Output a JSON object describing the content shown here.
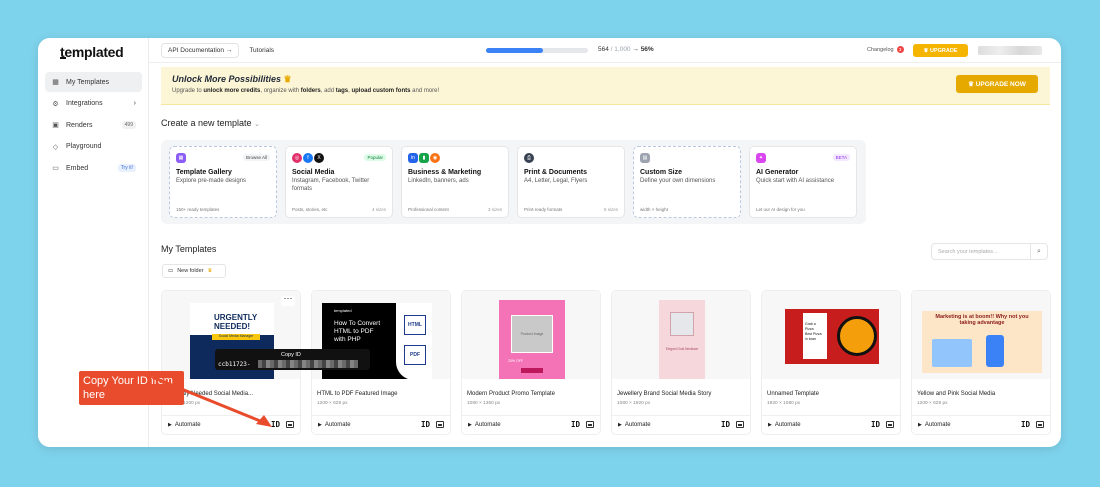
{
  "app": {
    "logo": "templated"
  },
  "sidebar": {
    "items": [
      {
        "label": "My Templates",
        "icon": "grid-icon",
        "badge": ""
      },
      {
        "label": "Integrations",
        "icon": "plug-icon",
        "badge": "›"
      },
      {
        "label": "Renders",
        "icon": "image-icon",
        "badge": "499"
      },
      {
        "label": "Playground",
        "icon": "gamepad-icon",
        "badge": ""
      },
      {
        "label": "Embed",
        "icon": "embed-icon",
        "badge": "Try it!"
      }
    ]
  },
  "topbar": {
    "api_docs": "API Documentation",
    "api_arrow": "→",
    "tutorials": "Tutorials",
    "usage": "564",
    "limit": "/ 1,000",
    "arrow": "→",
    "percent": "56%",
    "progress": 0.56,
    "changelog": "Changelog",
    "changelog_count": "3",
    "upgrade": "UPGRADE"
  },
  "banner": {
    "title": "Unlock More Possibilities",
    "sub_1": "Upgrade to ",
    "sub_b1": "unlock more credits",
    "sub_2": ", organize with ",
    "sub_b2": "folders",
    "sub_3": ", add ",
    "sub_b3": "tags",
    "sub_4": ", ",
    "sub_b4": "upload custom fonts",
    "sub_5": " and more!",
    "button": "UPGRADE NOW"
  },
  "create": {
    "title": "Create a new template",
    "chevron": "⌄",
    "cards": [
      {
        "title": "Template Gallery",
        "desc": "Explore pre-made designs",
        "foot": "150+ ready templates",
        "size": "",
        "tag": "Browse All"
      },
      {
        "title": "Social Media",
        "desc": "Instagram, Facebook, Twitter formats",
        "foot": "Posts, stories, etc",
        "size": "4 sizes",
        "tag": "Popular"
      },
      {
        "title": "Business & Marketing",
        "desc": "LinkedIn, banners, ads",
        "foot": "Professional content",
        "size": "3 sizes",
        "tag": ""
      },
      {
        "title": "Print & Documents",
        "desc": "A4, Letter, Legal, Flyers",
        "foot": "Print-ready formats",
        "size": "5 sizes",
        "tag": ""
      },
      {
        "title": "Custom Size",
        "desc": "Define your own dimensions",
        "foot": "width × height",
        "size": "",
        "tag": ""
      },
      {
        "title": "AI Generator",
        "desc": "Quick start with AI assistance",
        "foot": "Let our AI design for you",
        "size": "",
        "tag": "BETA"
      }
    ]
  },
  "my_templates": {
    "title": "My Templates",
    "search_placeholder": "Search your templates...",
    "new_folder": "New folder",
    "items": [
      {
        "name": "Urgently Needed Social Media...",
        "size": "1200 × 1200 px",
        "thumb_title": "URGENTLY NEEDED!",
        "thumb_sub": "Social Media Manager"
      },
      {
        "name": "HTML to PDF Featured Image",
        "size": "1200 × 628 px",
        "thumb_title": "How To Convert HTML to PDF with PHP",
        "thumb_sub": "templated"
      },
      {
        "name": "Modern Product Promo Template",
        "size": "1080 × 1350 px",
        "thumb_title": "Product Image",
        "thumb_sub": "20% OFF"
      },
      {
        "name": "Jewellery Brand Social Media Story",
        "size": "1080 × 1920 px",
        "thumb_title": "Elegant Gold Necklace",
        "thumb_sub": ""
      },
      {
        "name": "Unnamed Template",
        "size": "1920 × 1080 px",
        "thumb_title": "Grab a Pizza",
        "thumb_sub": "Best Pizza in town"
      },
      {
        "name": "Yellow and Pink Social Media",
        "size": "1200 × 628 px",
        "thumb_title": "Marketing is at boom!! Why not you taking advantage",
        "thumb_sub": ""
      }
    ],
    "automate_label": "Automate",
    "play_glyph": "▶",
    "id_label": "ID"
  },
  "tooltip": {
    "title": "Copy ID",
    "id_prefix": "ccb11723-"
  },
  "callout": {
    "text": "Copy Your ID from here"
  },
  "colors": {
    "accent": "#3b82f6",
    "upgrade": "#f5b400",
    "callout": "#e84c2c",
    "background": "#7ed3ec"
  }
}
